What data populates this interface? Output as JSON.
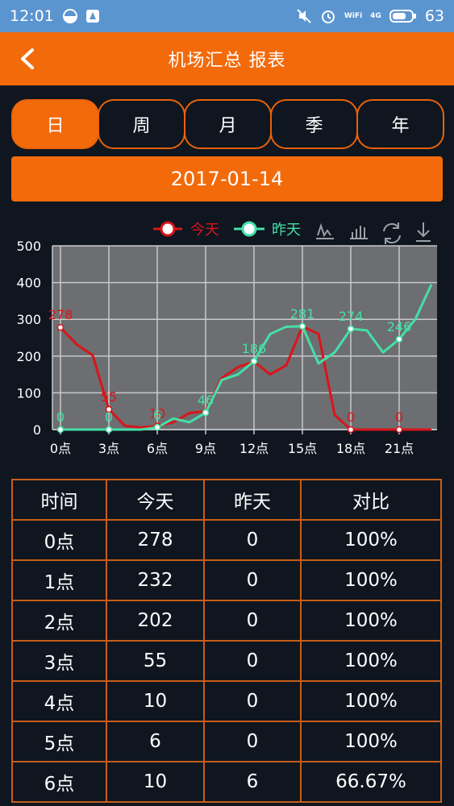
{
  "status": {
    "time": "12:01",
    "battery": "63",
    "net": "4G",
    "wifi_label": "WiFi"
  },
  "header": {
    "title": "机场汇总 报表"
  },
  "tabs": [
    {
      "label": "日",
      "active": true
    },
    {
      "label": "周",
      "active": false
    },
    {
      "label": "月",
      "active": false
    },
    {
      "label": "季",
      "active": false
    },
    {
      "label": "年",
      "active": false
    }
  ],
  "date": "2017-01-14",
  "colors": {
    "accent": "#f26a0a",
    "today": "#d9151b",
    "yesterday": "#44e0a6",
    "plot_bg": "#6d6e71"
  },
  "chart_data": {
    "type": "line",
    "legend": [
      "今天",
      "昨天"
    ],
    "x": [
      "0点",
      "1点",
      "2点",
      "3点",
      "4点",
      "5点",
      "6点",
      "7点",
      "8点",
      "9点",
      "10点",
      "11点",
      "12点",
      "13点",
      "14点",
      "15点",
      "16点",
      "17点",
      "18点",
      "19点",
      "20点",
      "21点",
      "22点",
      "23点"
    ],
    "xticks": [
      "0点",
      "3点",
      "6点",
      "9点",
      "12点",
      "15点",
      "18点",
      "21点"
    ],
    "yticks": [
      0,
      100,
      200,
      300,
      400,
      500
    ],
    "ylim": [
      0,
      500
    ],
    "grid": true,
    "legend_position": "top-right",
    "series": [
      {
        "name": "今天",
        "values": [
          278,
          232,
          202,
          55,
          10,
          6,
          10,
          20,
          45,
          50,
          140,
          170,
          185,
          150,
          175,
          281,
          260,
          40,
          0,
          0,
          0,
          0,
          0,
          0
        ]
      },
      {
        "name": "昨天",
        "values": [
          0,
          0,
          0,
          0,
          0,
          0,
          6,
          30,
          20,
          46,
          135,
          150,
          186,
          260,
          280,
          281,
          180,
          210,
          274,
          270,
          210,
          246,
          300,
          395
        ]
      }
    ],
    "labels": [
      {
        "series": 0,
        "x": 0,
        "text": "278"
      },
      {
        "series": 0,
        "x": 3,
        "text": "55"
      },
      {
        "series": 0,
        "x": 6,
        "text": "10"
      },
      {
        "series": 0,
        "x": 18,
        "text": "0"
      },
      {
        "series": 0,
        "x": 21,
        "text": "0"
      },
      {
        "series": 1,
        "x": 0,
        "text": "0"
      },
      {
        "series": 1,
        "x": 3,
        "text": "0"
      },
      {
        "series": 1,
        "x": 6,
        "text": "6"
      },
      {
        "series": 1,
        "x": 9,
        "text": "46"
      },
      {
        "series": 1,
        "x": 12,
        "text": "186"
      },
      {
        "series": 1,
        "x": 15,
        "text": "281"
      },
      {
        "series": 1,
        "x": 18,
        "text": "274"
      },
      {
        "series": 1,
        "x": 21,
        "text": "246"
      }
    ]
  },
  "table": {
    "headers": [
      "时间",
      "今天",
      "昨天",
      "对比"
    ],
    "rows": [
      [
        "0点",
        "278",
        "0",
        "100%"
      ],
      [
        "1点",
        "232",
        "0",
        "100%"
      ],
      [
        "2点",
        "202",
        "0",
        "100%"
      ],
      [
        "3点",
        "55",
        "0",
        "100%"
      ],
      [
        "4点",
        "10",
        "0",
        "100%"
      ],
      [
        "5点",
        "6",
        "0",
        "100%"
      ],
      [
        "6点",
        "10",
        "6",
        "66.67%"
      ]
    ]
  }
}
